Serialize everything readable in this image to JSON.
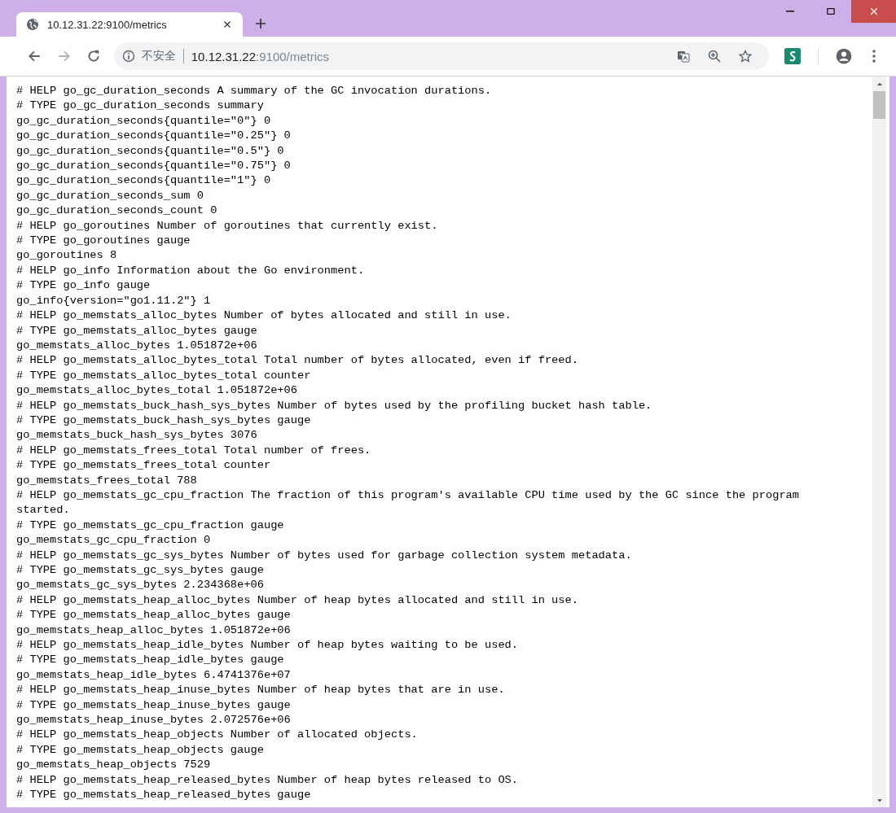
{
  "tab": {
    "title": "10.12.31.22:9100/metrics",
    "selected": true
  },
  "nav_buttons": [
    {
      "kind": "back",
      "disabled": false
    },
    {
      "kind": "forward",
      "disabled": true
    },
    {
      "kind": "reload",
      "disabled": false
    }
  ],
  "address_bar": {
    "security": "不安全",
    "host": "10.12.31.22",
    "path": ":9100/metrics"
  },
  "page_lines": [
    "# HELP go_gc_duration_seconds A summary of the GC invocation durations.",
    "# TYPE go_gc_duration_seconds summary",
    "go_gc_duration_seconds{quantile=\"0\"} 0",
    "go_gc_duration_seconds{quantile=\"0.25\"} 0",
    "go_gc_duration_seconds{quantile=\"0.5\"} 0",
    "go_gc_duration_seconds{quantile=\"0.75\"} 0",
    "go_gc_duration_seconds{quantile=\"1\"} 0",
    "go_gc_duration_seconds_sum 0",
    "go_gc_duration_seconds_count 0",
    "# HELP go_goroutines Number of goroutines that currently exist.",
    "# TYPE go_goroutines gauge",
    "go_goroutines 8",
    "# HELP go_info Information about the Go environment.",
    "# TYPE go_info gauge",
    "go_info{version=\"go1.11.2\"} 1",
    "# HELP go_memstats_alloc_bytes Number of bytes allocated and still in use.",
    "# TYPE go_memstats_alloc_bytes gauge",
    "go_memstats_alloc_bytes 1.051872e+06",
    "# HELP go_memstats_alloc_bytes_total Total number of bytes allocated, even if freed.",
    "# TYPE go_memstats_alloc_bytes_total counter",
    "go_memstats_alloc_bytes_total 1.051872e+06",
    "# HELP go_memstats_buck_hash_sys_bytes Number of bytes used by the profiling bucket hash table.",
    "# TYPE go_memstats_buck_hash_sys_bytes gauge",
    "go_memstats_buck_hash_sys_bytes 3076",
    "# HELP go_memstats_frees_total Total number of frees.",
    "# TYPE go_memstats_frees_total counter",
    "go_memstats_frees_total 788",
    "# HELP go_memstats_gc_cpu_fraction The fraction of this program's available CPU time used by the GC since the program started.",
    "# TYPE go_memstats_gc_cpu_fraction gauge",
    "go_memstats_gc_cpu_fraction 0",
    "# HELP go_memstats_gc_sys_bytes Number of bytes used for garbage collection system metadata.",
    "# TYPE go_memstats_gc_sys_bytes gauge",
    "go_memstats_gc_sys_bytes 2.234368e+06",
    "# HELP go_memstats_heap_alloc_bytes Number of heap bytes allocated and still in use.",
    "# TYPE go_memstats_heap_alloc_bytes gauge",
    "go_memstats_heap_alloc_bytes 1.051872e+06",
    "# HELP go_memstats_heap_idle_bytes Number of heap bytes waiting to be used.",
    "# TYPE go_memstats_heap_idle_bytes gauge",
    "go_memstats_heap_idle_bytes 6.4741376e+07",
    "# HELP go_memstats_heap_inuse_bytes Number of heap bytes that are in use.",
    "# TYPE go_memstats_heap_inuse_bytes gauge",
    "go_memstats_heap_inuse_bytes 2.072576e+06",
    "# HELP go_memstats_heap_objects Number of allocated objects.",
    "# TYPE go_memstats_heap_objects gauge",
    "go_memstats_heap_objects 7529",
    "# HELP go_memstats_heap_released_bytes Number of heap bytes released to OS.",
    "# TYPE go_memstats_heap_released_bytes gauge"
  ]
}
